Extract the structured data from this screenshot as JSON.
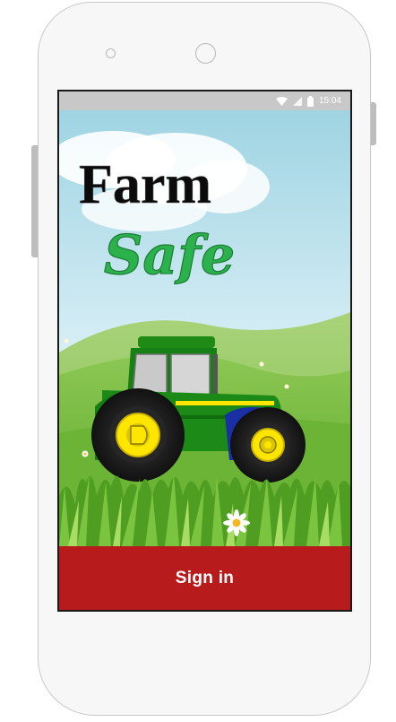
{
  "status_bar": {
    "time": "15:04",
    "icons": [
      "wifi-icon",
      "signal-icon",
      "battery-icon"
    ]
  },
  "app": {
    "title_line1": "Farm",
    "title_line2": "Safe"
  },
  "sign_in": {
    "label": "Sign in",
    "color": "#b81b1b"
  },
  "colors": {
    "tractor_green": "#1f8a16",
    "tractor_yellow": "#ffe600",
    "sky": "#a8d8e6",
    "grass": "#5aa82a"
  }
}
